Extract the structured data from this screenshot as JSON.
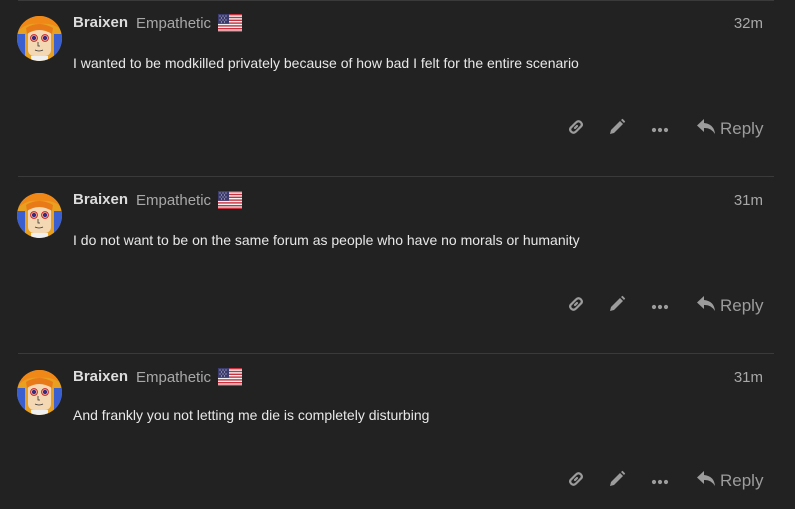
{
  "posts": [
    {
      "username": "Braixen",
      "user_title": "Empathetic",
      "flag": "us-flag-icon",
      "time": "32m",
      "body": "I wanted to be modkilled privately because of how bad I felt for the entire scenario",
      "reply_label": "Reply"
    },
    {
      "username": "Braixen",
      "user_title": "Empathetic",
      "flag": "us-flag-icon",
      "time": "31m",
      "body": "I do not want to be on the same forum as people who have no morals or humanity",
      "reply_label": "Reply"
    },
    {
      "username": "Braixen",
      "user_title": "Empathetic",
      "flag": "us-flag-icon",
      "time": "31m",
      "body": "And frankly you not letting me die is completely disturbing",
      "reply_label": "Reply"
    }
  ],
  "icons": {
    "share": "link-icon",
    "edit": "pencil-icon",
    "more": "ellipsis-icon",
    "reply": "reply-arrow-icon"
  },
  "colors": {
    "background": "#222222",
    "text": "#e8e8e8",
    "muted": "#a8a8a8",
    "icon": "#9c9c9c"
  }
}
